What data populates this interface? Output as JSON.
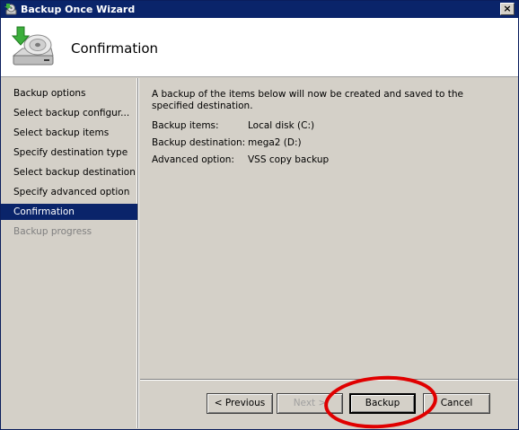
{
  "window": {
    "title": "Backup Once Wizard",
    "close_label": "×"
  },
  "header": {
    "title": "Confirmation"
  },
  "sidebar": {
    "items": [
      {
        "label": "Backup options",
        "state": "normal"
      },
      {
        "label": "Select backup configur...",
        "state": "normal"
      },
      {
        "label": "Select backup items",
        "state": "normal"
      },
      {
        "label": "Specify destination type",
        "state": "normal"
      },
      {
        "label": "Select backup destination",
        "state": "normal"
      },
      {
        "label": "Specify advanced option",
        "state": "normal"
      },
      {
        "label": "Confirmation",
        "state": "selected"
      },
      {
        "label": "Backup progress",
        "state": "disabled"
      }
    ]
  },
  "main": {
    "intro": "A backup of the items below will now be created and saved to the specified destination.",
    "details": [
      {
        "label": "Backup items:",
        "value": "Local disk (C:)"
      },
      {
        "label": "Backup destination:",
        "value": "mega2 (D:)"
      },
      {
        "label": "Advanced option:",
        "value": "VSS copy backup"
      }
    ]
  },
  "buttons": {
    "previous": "< Previous",
    "next": "Next >",
    "backup": "Backup",
    "cancel": "Cancel"
  },
  "colors": {
    "titlebar": "#0a246a",
    "selection": "#0a246a",
    "annotation_circle": "#e00000"
  },
  "icons": {
    "title_icon": "backup-wizard-icon",
    "header_icon": "backup-disk-icon"
  }
}
